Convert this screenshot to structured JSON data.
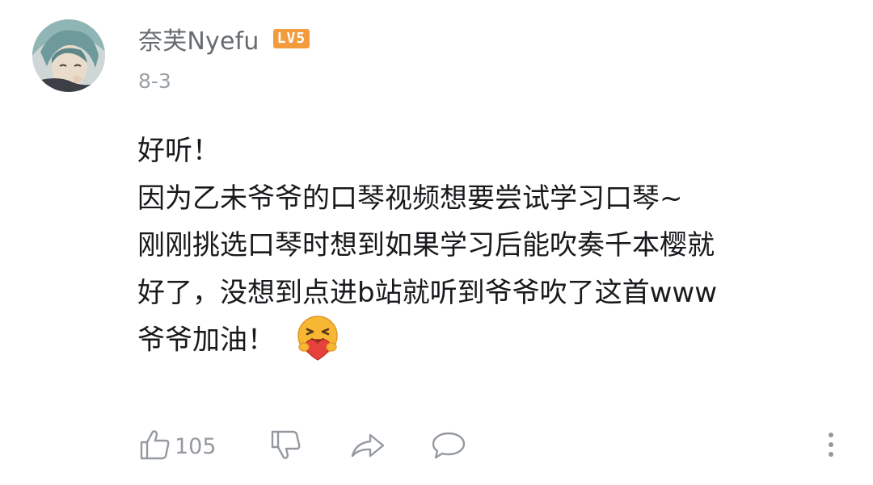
{
  "comment": {
    "username": "奈芙Nyefu",
    "level": "LV5",
    "date": "8-3",
    "lines": [
      "好听！",
      "因为乙未爷爷的口琴视频想要尝试学习口琴~",
      "刚刚挑选口琴时想到如果学习后能吹奏千本樱就",
      "好了，没想到点进b站就听到爷爷吹了这首www",
      "爷爷加油！"
    ],
    "emoji": "hug-heart-emoji",
    "like_count": "105"
  },
  "icons": {
    "like": "thumbs-up-icon",
    "dislike": "thumbs-down-icon",
    "share": "share-icon",
    "reply": "reply-icon",
    "more": "more-vertical-icon"
  },
  "colors": {
    "text": "#18191c",
    "username": "#666b70",
    "meta": "#9aa0a4",
    "level_badge": "#f39c3d"
  }
}
